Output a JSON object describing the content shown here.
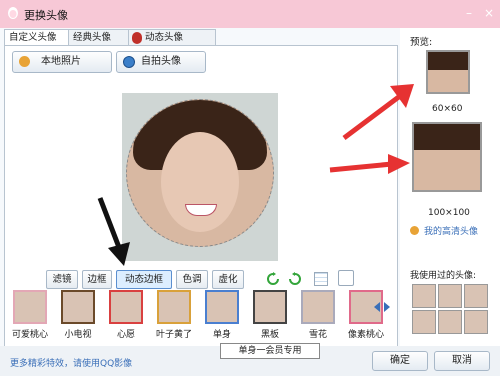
{
  "window": {
    "title": "更换头像",
    "close_label": "×",
    "min_label": "–"
  },
  "tabs": [
    {
      "label": "自定义头像"
    },
    {
      "label": "经典头像"
    },
    {
      "label": "动态头像"
    }
  ],
  "actions": {
    "local_photo": "本地照片",
    "selfie": "自拍头像"
  },
  "toolbar": {
    "items": [
      "滤镜",
      "边框",
      "动态边框",
      "色调",
      "虚化"
    ],
    "active": "动态边框"
  },
  "thumbs": [
    "可爱桃心",
    "小电视",
    "心愿",
    "叶子黄了",
    "单身",
    "黑板",
    "雪花",
    "像素桃心"
  ],
  "tooltip": "单身一会员专用",
  "footer": {
    "link": "更多精彩特效，请使用QQ影像",
    "ok": "确定",
    "cancel": "取消"
  },
  "preview": {
    "title": "预览:",
    "size_small": "60×60",
    "size_large": "100×100",
    "hd_link": "我的高清头像",
    "history_title": "我使用过的头像:"
  },
  "colors": {
    "accent": "#f7c8d6",
    "link": "#3a6fb8",
    "arrow_red": "#e63232"
  }
}
